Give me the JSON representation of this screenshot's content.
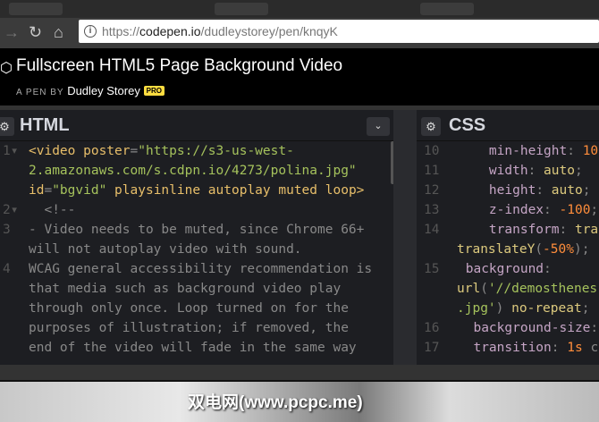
{
  "browser": {
    "url_host": "codepen.io",
    "url_prefix": "https://",
    "url_path": "/dudleystorey/pen/knqyK"
  },
  "header": {
    "title": "Fullscreen HTML5 Page Background Video",
    "byline": "A PEN BY",
    "author": "Dudley Storey",
    "badge": "PRO"
  },
  "html_panel": {
    "title": "HTML"
  },
  "css_panel": {
    "title": "CSS"
  },
  "watermark": "双电网(www.pcpc.me)",
  "html_lines": [
    {
      "n": "1",
      "fold": true,
      "segs": [
        [
          "t",
          "<video "
        ],
        [
          "a",
          "poster"
        ],
        [
          "c",
          "="
        ],
        [
          "s",
          "\"https://s3-us-west-"
        ]
      ]
    },
    {
      "n": "",
      "segs": [
        [
          "s",
          "2.amazonaws.com/s.cdpn.io/4273/polina.jpg\""
        ]
      ]
    },
    {
      "n": "",
      "segs": [
        [
          "a",
          "id"
        ],
        [
          "c",
          "="
        ],
        [
          "s",
          "\"bgvid\" "
        ],
        [
          "a",
          "playsinline autoplay muted loop"
        ],
        [
          "t",
          ">"
        ]
      ]
    },
    {
      "n": "2",
      "fold": true,
      "segs": [
        [
          "c",
          "  <!--"
        ]
      ]
    },
    {
      "n": "3",
      "segs": [
        [
          "c",
          "- Video needs to be muted, since Chrome 66+"
        ]
      ]
    },
    {
      "n": "",
      "segs": [
        [
          "c",
          "will not autoplay video with sound."
        ]
      ]
    },
    {
      "n": "4",
      "segs": [
        [
          "c",
          "WCAG general accessibility recommendation is"
        ]
      ]
    },
    {
      "n": "",
      "segs": [
        [
          "c",
          "that media such as background video play"
        ]
      ]
    },
    {
      "n": "",
      "segs": [
        [
          "c",
          "through only once. Loop turned on for the"
        ]
      ]
    },
    {
      "n": "",
      "segs": [
        [
          "c",
          "purposes of illustration; if removed, the"
        ]
      ]
    },
    {
      "n": "",
      "segs": [
        [
          "c",
          "end of the video will fade in the same way"
        ]
      ]
    }
  ],
  "css_lines": [
    {
      "n": "10",
      "indent": "    ",
      "segs": [
        [
          "p",
          "min-height"
        ],
        [
          "c",
          ": "
        ],
        [
          "n",
          "10"
        ]
      ]
    },
    {
      "n": "11",
      "indent": "    ",
      "segs": [
        [
          "p",
          "width"
        ],
        [
          "c",
          ": "
        ],
        [
          "v",
          "auto"
        ],
        [
          "c",
          ";"
        ]
      ]
    },
    {
      "n": "12",
      "indent": "    ",
      "segs": [
        [
          "p",
          "height"
        ],
        [
          "c",
          ": "
        ],
        [
          "v",
          "auto"
        ],
        [
          "c",
          ";"
        ]
      ]
    },
    {
      "n": "13",
      "indent": "    ",
      "segs": [
        [
          "p",
          "z-index"
        ],
        [
          "c",
          ": "
        ],
        [
          "n",
          "-100"
        ],
        [
          "c",
          ";"
        ]
      ]
    },
    {
      "n": "14",
      "indent": "    ",
      "segs": [
        [
          "p",
          "transform"
        ],
        [
          "c",
          ": "
        ],
        [
          "v",
          "tra"
        ]
      ]
    },
    {
      "n": "",
      "wrap": true,
      "segs": [
        [
          "v",
          "translateY"
        ],
        [
          "c",
          "("
        ],
        [
          "n",
          "-50%"
        ],
        [
          "c",
          ");"
        ]
      ]
    },
    {
      "n": "15",
      "indent": " ",
      "segs": [
        [
          "p",
          "background"
        ],
        [
          "c",
          ":"
        ]
      ]
    },
    {
      "n": "",
      "wrap": true,
      "segs": [
        [
          "v",
          "url"
        ],
        [
          "c",
          "("
        ],
        [
          "s",
          "'//demosthenes"
        ]
      ]
    },
    {
      "n": "",
      "wrap": true,
      "segs": [
        [
          "s",
          ".jpg'"
        ],
        [
          "c",
          ") "
        ],
        [
          "v",
          "no-repeat"
        ],
        [
          "c",
          ";"
        ]
      ]
    },
    {
      "n": "16",
      "indent": "  ",
      "segs": [
        [
          "p",
          "background-size"
        ],
        [
          "c",
          ":"
        ]
      ]
    },
    {
      "n": "17",
      "indent": "  ",
      "segs": [
        [
          "p",
          "transition"
        ],
        [
          "c",
          ": "
        ],
        [
          "n",
          "1s"
        ],
        [
          "c",
          " c"
        ]
      ]
    }
  ]
}
